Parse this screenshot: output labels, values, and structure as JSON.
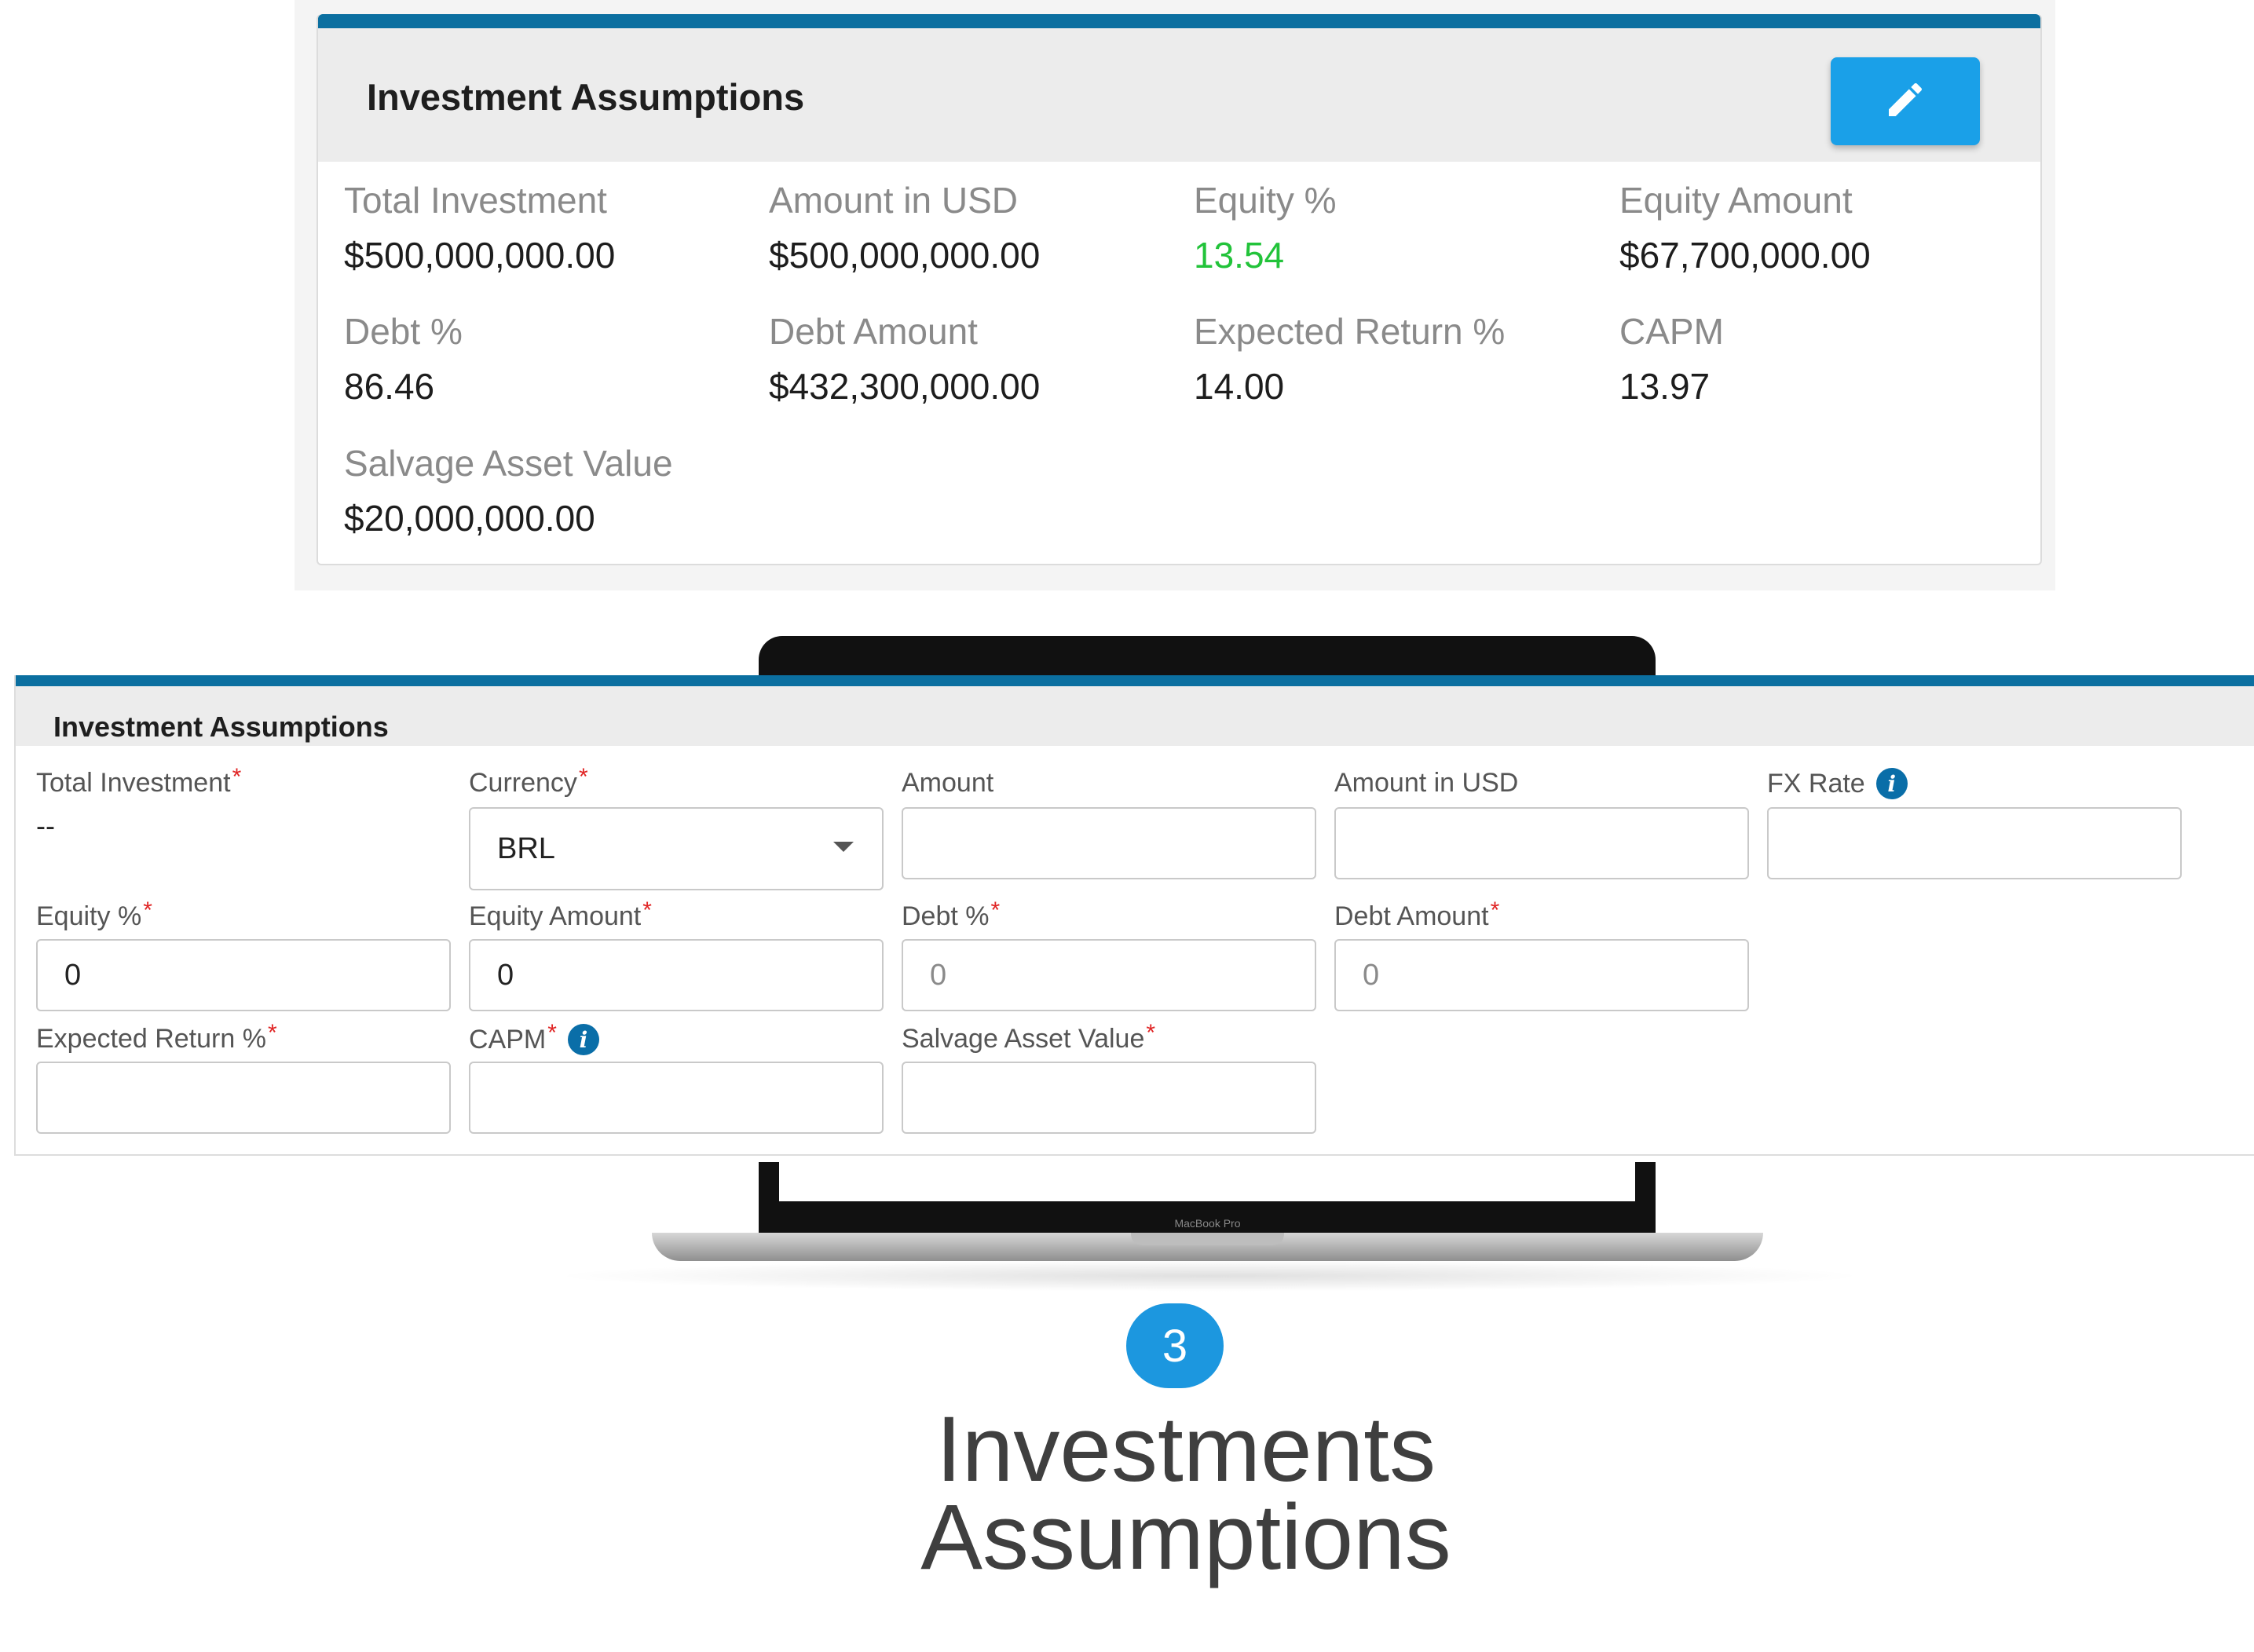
{
  "view_card": {
    "title": "Investment Assumptions",
    "edit_icon": "pencil-icon",
    "fields": [
      {
        "label": "Total Investment",
        "value": "$500,000,000.00"
      },
      {
        "label": "Amount in USD",
        "value": "$500,000,000.00"
      },
      {
        "label": "Equity %",
        "value": "13.54"
      },
      {
        "label": "Equity Amount",
        "value": "$67,700,000.00"
      },
      {
        "label": "Debt %",
        "value": "86.46"
      },
      {
        "label": "Debt Amount",
        "value": "$432,300,000.00"
      },
      {
        "label": "Expected Return %",
        "value": "14.00"
      },
      {
        "label": "CAPM",
        "value": "13.97"
      },
      {
        "label": "Salvage Asset Value",
        "value": "$20,000,000.00"
      }
    ],
    "highlight_color": "#22c33a"
  },
  "edit_form": {
    "title": "Investment Assumptions",
    "total_investment": {
      "label": "Total Investment",
      "value": "--"
    },
    "currency": {
      "label": "Currency",
      "value": "BRL"
    },
    "amount": {
      "label": "Amount",
      "value": ""
    },
    "amount_usd": {
      "label": "Amount in USD",
      "value": ""
    },
    "fx_rate": {
      "label": "FX Rate",
      "value": ""
    },
    "equity_pct": {
      "label": "Equity %",
      "value": "0"
    },
    "equity_amount": {
      "label": "Equity Amount",
      "value": "0"
    },
    "debt_pct": {
      "label": "Debt %",
      "value": "0"
    },
    "debt_amount": {
      "label": "Debt Amount",
      "value": "0"
    },
    "expected_return": {
      "label": "Expected Return %",
      "value": ""
    },
    "capm": {
      "label": "CAPM",
      "value": ""
    },
    "salvage": {
      "label": "Salvage Asset Value",
      "value": ""
    },
    "required_mark": "*",
    "info_glyph": "i"
  },
  "laptop_label": "MacBook Pro",
  "step": {
    "number": "3"
  },
  "caption": {
    "line1": "Investments",
    "line2": "Assumptions"
  },
  "colors": {
    "accent_bar": "#0b6fa0",
    "edit_button": "#1aa0e8",
    "step_badge": "#1c97df",
    "required": "#e02424"
  }
}
